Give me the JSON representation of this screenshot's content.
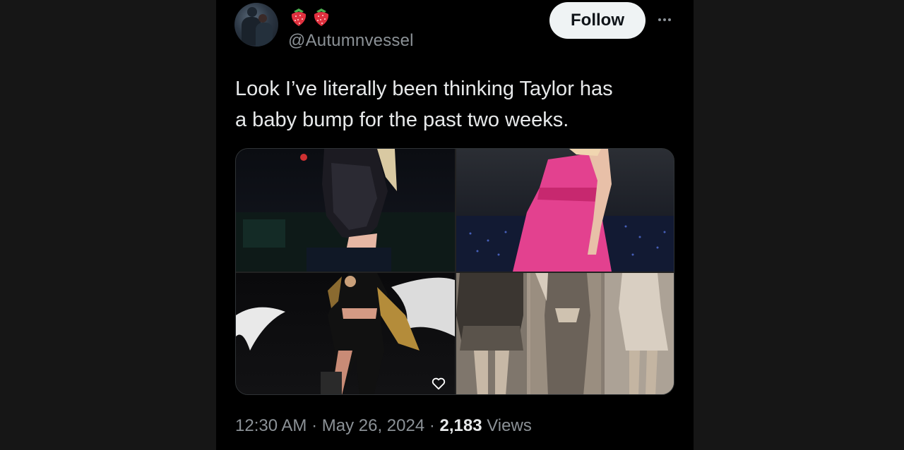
{
  "tweet": {
    "handle": "@Autumnvessel",
    "display_name_emojis": [
      "strawberry-icon",
      "strawberry-icon"
    ],
    "follow_label": "Follow",
    "text_line1": "Look I’ve literally been thinking Taylor has",
    "text_line2": "a baby bump for the past two weeks.",
    "time": "12:30 AM",
    "separator": " · ",
    "date": "May 26, 2024",
    "views_count": "2,183",
    "views_label": " Views"
  },
  "media": {
    "images": [
      "image-sequined-bodysuit",
      "image-pink-dress",
      "image-black-outfit-feathers",
      "image-three-figures-sepia"
    ],
    "overlay_icon": "heart-icon"
  },
  "colors": {
    "background": "#000000",
    "outer": "#161616",
    "text": "#e7e9ea",
    "muted": "#8b9196",
    "follow_bg": "#eff3f4",
    "strawberry": "#e0313f"
  }
}
